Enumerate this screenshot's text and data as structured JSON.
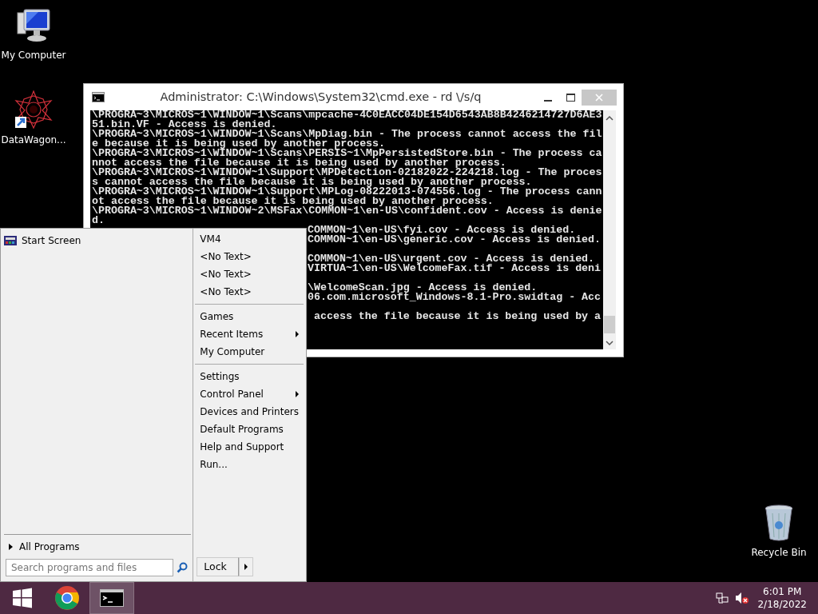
{
  "desktop_icons": [
    {
      "label": "My Computer",
      "kind": "computer"
    },
    {
      "label": "DataWagon...",
      "kind": "shortcut"
    },
    {
      "label": "Recycle Bin",
      "kind": "bin"
    }
  ],
  "console_window": {
    "title": "Administrator: C:\\Windows\\System32\\cmd.exe - rd \\/s/q",
    "lines": [
      "\\PROGRA~3\\MICROS~1\\WINDOW~1\\Scans\\mpcache-4C0EACC04DE154D6543AB8B4246214727D6AE3",
      "51.bin.VF - Access is denied.",
      "\\PROGRA~3\\MICROS~1\\WINDOW~1\\Scans\\MpDiag.bin - The process cannot access the fil",
      "e because it is being used by another process.",
      "\\PROGRA~3\\MICROS~1\\WINDOW~1\\Scans\\PERSIS~1\\MpPersistedStore.bin - The process ca",
      "nnot access the file because it is being used by another process.",
      "\\PROGRA~3\\MICROS~1\\WINDOW~1\\Support\\MPDetection-02182022-224218.log - The proces",
      "s cannot access the file because it is being used by another process.",
      "\\PROGRA~3\\MICROS~1\\WINDOW~1\\Support\\MPLog-08222013-074556.log - The process cann",
      "ot access the file because it is being used by another process.",
      "\\PROGRA~3\\MICROS~1\\WINDOW~2\\MSFax\\COMMON~1\\en-US\\confident.cov - Access is denie",
      "d."
    ],
    "lines_beside_menu": [
      {
        "kind": "text",
        "text": "COMMON~1\\en-US\\fyi.cov - Access is denied."
      },
      {
        "kind": "text",
        "text": "COMMON~1\\en-US\\generic.cov - Access is denied."
      },
      {
        "kind": "blank"
      },
      {
        "kind": "text",
        "text": "COMMON~1\\en-US\\urgent.cov - Access is denied."
      },
      {
        "kind": "text",
        "text": "VIRTUA~1\\en-US\\WelcomeFax.tif - Access is deni"
      },
      {
        "kind": "blank"
      },
      {
        "kind": "text",
        "text": "\\WelcomeScan.jpg - Access is denied."
      },
      {
        "kind": "text",
        "text": "06.com.microsoft_Windows-8.1-Pro.swidtag - Acc"
      },
      {
        "kind": "blank"
      },
      {
        "kind": "text",
        "text": " access the file because it is being used by a"
      }
    ]
  },
  "start_menu": {
    "programs": [
      {
        "label": "Start Screen"
      }
    ],
    "all_programs": "All Programs",
    "search": {
      "placeholder": "Search programs and files"
    },
    "places": [
      {
        "kind": "item",
        "label": "VM4",
        "submenu": false
      },
      {
        "kind": "item",
        "label": "<No Text>",
        "submenu": false
      },
      {
        "kind": "item",
        "label": "<No Text>",
        "submenu": false
      },
      {
        "kind": "item",
        "label": "<No Text>",
        "submenu": false
      },
      {
        "kind": "separator"
      },
      {
        "kind": "item",
        "label": "Games",
        "submenu": false
      },
      {
        "kind": "item",
        "label": "Recent Items",
        "submenu": true
      },
      {
        "kind": "item",
        "label": "My Computer",
        "submenu": false
      },
      {
        "kind": "separator"
      },
      {
        "kind": "item",
        "label": "Settings",
        "submenu": false
      },
      {
        "kind": "item",
        "label": "Control Panel",
        "submenu": true
      },
      {
        "kind": "item",
        "label": "Devices and Printers",
        "submenu": false
      },
      {
        "kind": "item",
        "label": "Default Programs",
        "submenu": false
      },
      {
        "kind": "item",
        "label": "Help and Support",
        "submenu": false
      },
      {
        "kind": "item",
        "label": "Run...",
        "submenu": false
      }
    ],
    "power_button": "Lock"
  },
  "taskbar": {
    "apps": [
      {
        "kind": "browser",
        "selected": false
      },
      {
        "kind": "console",
        "selected": true
      }
    ],
    "time": "6:01 PM",
    "date": "2/18/2022"
  }
}
